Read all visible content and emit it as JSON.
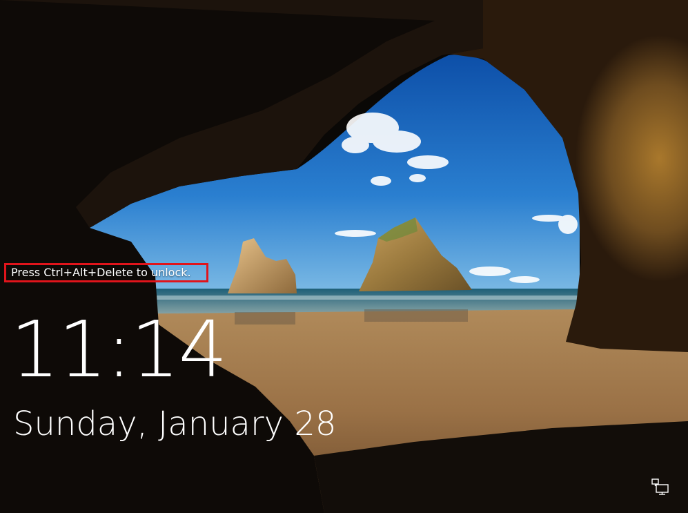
{
  "lock_screen": {
    "unlock_hint": "Press Ctrl+Alt+Delete to unlock.",
    "time": "11:14",
    "date": "Sunday, January 28"
  },
  "icons": {
    "network": "network-icon"
  },
  "colors": {
    "highlight_border": "#e0141b",
    "text": "#ffffff"
  }
}
